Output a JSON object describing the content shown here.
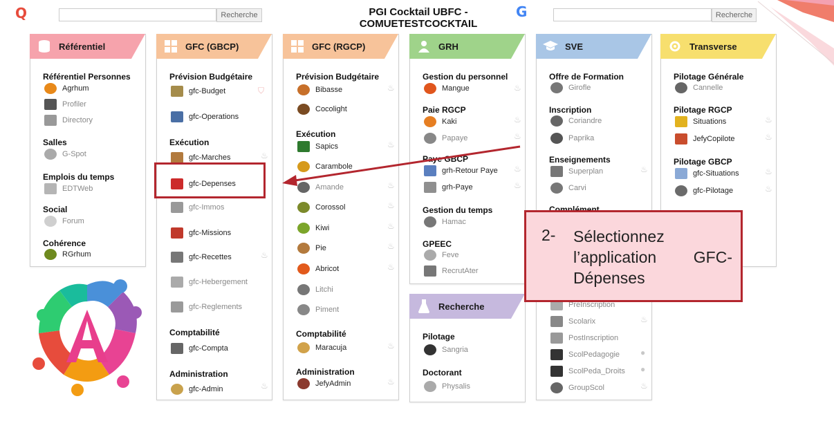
{
  "topbar": {
    "search_label_left": "Recherche",
    "search_label_right": "Recherche",
    "title_line1": "PGI Cocktail UBFC -",
    "title_line2": "COMUETESTCOCKTAIL",
    "left_logo": "Q",
    "right_logo": "G"
  },
  "panels": [
    {
      "key": "referentiel",
      "title": "Référentiel",
      "color": "#f6a3ac",
      "icon": "database-icon",
      "sections": [
        {
          "title": "Référentiel Personnes",
          "apps": [
            "Agrhum",
            "Profiler",
            "Directory"
          ]
        },
        {
          "title": "Salles",
          "apps": [
            "G-Spot"
          ]
        },
        {
          "title": "Emplois du temps",
          "apps": [
            "EDTWeb"
          ]
        },
        {
          "title": "Social",
          "apps": [
            "Forum"
          ]
        },
        {
          "title": "Cohérence",
          "apps": [
            "RGrhum"
          ]
        }
      ]
    },
    {
      "key": "gfc_gbcp",
      "title": "GFC (GBCP)",
      "color": "#f7c39a",
      "icon": "grid-icon",
      "sections": [
        {
          "title": "Prévision Budgétaire",
          "apps": [
            "gfc-Budget",
            "gfc-Operations"
          ]
        },
        {
          "title": "Exécution",
          "apps": [
            "gfc-Marches",
            "gfc-Depenses",
            "gfc-Immos",
            "gfc-Missions",
            "gfc-Recettes",
            "gfc-Hebergement",
            "gfc-Reglements"
          ]
        },
        {
          "title": "Comptabilité",
          "apps": [
            "gfc-Compta"
          ]
        },
        {
          "title": "Administration",
          "apps": [
            "gfc-Admin"
          ]
        }
      ]
    },
    {
      "key": "gfc_rgcp",
      "title": "GFC (RGCP)",
      "color": "#f7c39a",
      "icon": "grid-icon",
      "sections": [
        {
          "title": "Prévision Budgétaire",
          "apps": [
            "Bibasse",
            "Cocolight"
          ]
        },
        {
          "title": "Exécution",
          "apps": [
            "Sapics",
            "Carambole",
            "Amande",
            "Corossol",
            "Kiwi",
            "Pie",
            "Abricot",
            "Litchi",
            "Piment"
          ]
        },
        {
          "title": "Comptabilité",
          "apps": [
            "Maracuja"
          ]
        },
        {
          "title": "Administration",
          "apps": [
            "JefyAdmin"
          ]
        }
      ]
    },
    {
      "key": "grh",
      "title": "GRH",
      "color": "#9fd38a",
      "icon": "people-icon",
      "sections": [
        {
          "title": "Gestion du personnel",
          "apps": [
            "Mangue"
          ]
        },
        {
          "title": "Paie RGCP",
          "apps": [
            "Kaki",
            "Papaye"
          ]
        },
        {
          "title": "Paye GBCP",
          "apps": [
            "grh-Retour Paye",
            "grh-Paye"
          ]
        },
        {
          "title": "Gestion du temps",
          "apps": [
            "Hamac"
          ]
        },
        {
          "title": "GPEEC",
          "apps": [
            "Feve",
            "RecrutAter"
          ]
        }
      ]
    },
    {
      "key": "recherche",
      "title": "Recherche",
      "color": "#c6b9de",
      "icon": "flask-icon",
      "sections": [
        {
          "title": "Pilotage",
          "apps": [
            "Sangria"
          ]
        },
        {
          "title": "Doctorant",
          "apps": [
            "Physalis"
          ]
        }
      ]
    },
    {
      "key": "sve",
      "title": "SVE",
      "color": "#a9c6e6",
      "icon": "graduation-cap-icon",
      "sections": [
        {
          "title": "Offre de Formation",
          "apps": [
            "Girofle"
          ]
        },
        {
          "title": "Inscription",
          "apps": [
            "Coriandre",
            "Paprika"
          ]
        },
        {
          "title": "Enseignements",
          "apps": [
            "Superplan",
            "Carvi"
          ]
        },
        {
          "title": "Complément",
          "apps": [
            "PreInscription",
            "Scolarix",
            "PostInscription",
            "ScolPedagogie",
            "ScolPeda_Droits",
            "GroupScol"
          ]
        }
      ]
    },
    {
      "key": "transverse",
      "title": "Transverse",
      "color": "#f7df6e",
      "icon": "gear-icon",
      "sections": [
        {
          "title": "Pilotage Générale",
          "apps": [
            "Cannelle"
          ]
        },
        {
          "title": "Pilotage RGCP",
          "apps": [
            "Situations",
            "JefyCopilote"
          ]
        },
        {
          "title": "Pilotage GBCP",
          "apps": [
            "gfc-Situations",
            "gfc-Pilotage"
          ]
        }
      ]
    }
  ],
  "callout": {
    "number": "2-",
    "text": "Sélectionnez l’application GFC-Dépenses"
  },
  "colors": {
    "annotation_red": "#b3262e",
    "callout_bg": "#fbd7dc"
  }
}
